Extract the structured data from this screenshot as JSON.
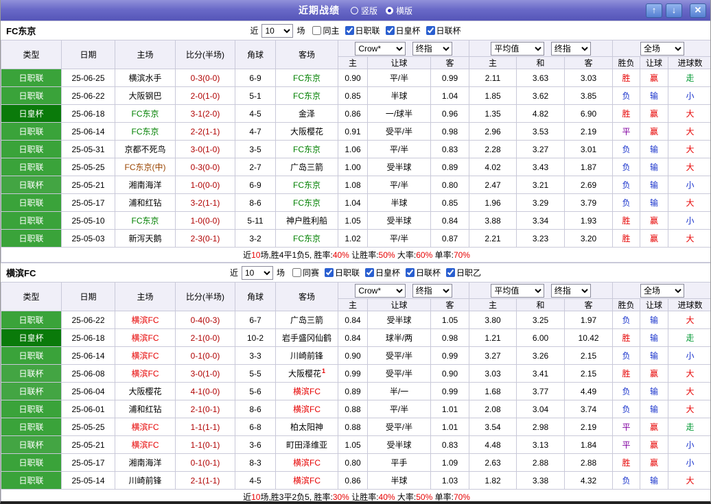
{
  "titlebar": {
    "title": "近期战绩",
    "radios": [
      {
        "label": "竖版",
        "selected": false
      },
      {
        "label": "横版",
        "selected": true
      }
    ],
    "buttons": {
      "up": "↑",
      "down": "↓",
      "close": "✕"
    }
  },
  "controls": {
    "odds_company": "Crow*",
    "odds_stage": "终指",
    "avg": "平均值",
    "avg_stage": "终指",
    "scope": "全场"
  },
  "columns": {
    "type": "类型",
    "date": "日期",
    "home": "主场",
    "score": "比分(半场)",
    "corners": "角球",
    "away": "客场",
    "odds_home": "主",
    "odds_handicap": "让球",
    "odds_away": "客",
    "avg_home": "主",
    "avg_draw": "和",
    "avg_away": "客",
    "result_wdl": "胜负",
    "result_handicap": "让球",
    "result_goals": "进球数"
  },
  "colors": {
    "accent": "#6565c8",
    "score": "#b00000",
    "type": {
      "日职联": "#3aa33a",
      "日皇杯": "#0a7a0a",
      "日联杯": "#43a543",
      "日职乙": "#3aa33a"
    },
    "team": {
      "green": "#008000",
      "red": "#e60000",
      "maroon": "#994400",
      "default": "#000000"
    },
    "result": {
      "胜": "#e60000",
      "赢": "#e60000",
      "大": "#e60000",
      "负": "#1933cc",
      "输": "#1933cc",
      "小": "#1933cc",
      "平": "#8000a0",
      "走": "#009933"
    }
  },
  "sections": [
    {
      "team": "FC东京",
      "filter": {
        "near": "近",
        "count": "10",
        "games": "场",
        "checkboxes": [
          {
            "label": "同主",
            "checked": false
          },
          {
            "label": "日职联",
            "checked": true
          },
          {
            "label": "日皇杯",
            "checked": true
          },
          {
            "label": "日联杯",
            "checked": true
          }
        ]
      },
      "rows": [
        {
          "type": "日职联",
          "date": "25-06-25",
          "home": {
            "name": "横滨水手"
          },
          "score": "0-3(0-0)",
          "corners": "6-9",
          "away": {
            "name": "FC东京",
            "color": "green"
          },
          "odds": [
            "0.90",
            "平/半",
            "0.99"
          ],
          "avg": [
            "2.11",
            "3.63",
            "3.03"
          ],
          "results": [
            "胜",
            "赢",
            "走"
          ]
        },
        {
          "type": "日职联",
          "date": "25-06-22",
          "home": {
            "name": "大阪钢巴"
          },
          "score": "2-0(1-0)",
          "corners": "5-1",
          "away": {
            "name": "FC东京",
            "color": "green"
          },
          "odds": [
            "0.85",
            "半球",
            "1.04"
          ],
          "avg": [
            "1.85",
            "3.62",
            "3.85"
          ],
          "results": [
            "负",
            "输",
            "小"
          ]
        },
        {
          "type": "日皇杯",
          "date": "25-06-18",
          "home": {
            "name": "FC东京",
            "color": "green"
          },
          "score": "3-1(2-0)",
          "corners": "4-5",
          "away": {
            "name": "金泽"
          },
          "odds": [
            "0.86",
            "一/球半",
            "0.96"
          ],
          "avg": [
            "1.35",
            "4.82",
            "6.90"
          ],
          "results": [
            "胜",
            "赢",
            "大"
          ]
        },
        {
          "type": "日职联",
          "date": "25-06-14",
          "home": {
            "name": "FC东京",
            "color": "green"
          },
          "score": "2-2(1-1)",
          "corners": "4-7",
          "away": {
            "name": "大阪樱花"
          },
          "odds": [
            "0.91",
            "受平/半",
            "0.98"
          ],
          "avg": [
            "2.96",
            "3.53",
            "2.19"
          ],
          "results": [
            "平",
            "赢",
            "大"
          ]
        },
        {
          "type": "日职联",
          "date": "25-05-31",
          "home": {
            "name": "京都不死鸟"
          },
          "score": "3-0(1-0)",
          "corners": "3-5",
          "away": {
            "name": "FC东京",
            "color": "green"
          },
          "odds": [
            "1.06",
            "平/半",
            "0.83"
          ],
          "avg": [
            "2.28",
            "3.27",
            "3.01"
          ],
          "results": [
            "负",
            "输",
            "大"
          ]
        },
        {
          "type": "日职联",
          "date": "25-05-25",
          "home": {
            "name": "FC东京(中)",
            "color": "maroon"
          },
          "score": "0-3(0-0)",
          "corners": "2-7",
          "away": {
            "name": "广岛三箭"
          },
          "odds": [
            "1.00",
            "受半球",
            "0.89"
          ],
          "avg": [
            "4.02",
            "3.43",
            "1.87"
          ],
          "results": [
            "负",
            "输",
            "大"
          ]
        },
        {
          "type": "日联杯",
          "date": "25-05-21",
          "home": {
            "name": "湘南海洋"
          },
          "score": "1-0(0-0)",
          "corners": "6-9",
          "away": {
            "name": "FC东京",
            "color": "green"
          },
          "odds": [
            "1.08",
            "平/半",
            "0.80"
          ],
          "avg": [
            "2.47",
            "3.21",
            "2.69"
          ],
          "results": [
            "负",
            "输",
            "小"
          ]
        },
        {
          "type": "日职联",
          "date": "25-05-17",
          "home": {
            "name": "浦和红钻"
          },
          "score": "3-2(1-1)",
          "corners": "8-6",
          "away": {
            "name": "FC东京",
            "color": "green"
          },
          "odds": [
            "1.04",
            "半球",
            "0.85"
          ],
          "avg": [
            "1.96",
            "3.29",
            "3.79"
          ],
          "results": [
            "负",
            "输",
            "大"
          ]
        },
        {
          "type": "日职联",
          "date": "25-05-10",
          "home": {
            "name": "FC东京",
            "color": "green"
          },
          "score": "1-0(0-0)",
          "corners": "5-11",
          "away": {
            "name": "神户胜利船"
          },
          "odds": [
            "1.05",
            "受半球",
            "0.84"
          ],
          "avg": [
            "3.88",
            "3.34",
            "1.93"
          ],
          "results": [
            "胜",
            "赢",
            "小"
          ]
        },
        {
          "type": "日职联",
          "date": "25-05-03",
          "home": {
            "name": "新泻天鹅"
          },
          "score": "2-3(0-1)",
          "corners": "3-2",
          "away": {
            "name": "FC东京",
            "color": "green"
          },
          "odds": [
            "1.02",
            "平/半",
            "0.87"
          ],
          "avg": [
            "2.21",
            "3.23",
            "3.20"
          ],
          "results": [
            "胜",
            "赢",
            "大"
          ]
        }
      ],
      "footer": [
        {
          "t": "近"
        },
        {
          "t": "10",
          "red": true
        },
        {
          "t": "场,胜4平1负5, 胜率:"
        },
        {
          "t": "40%",
          "red": true
        },
        {
          "t": " 让胜率:"
        },
        {
          "t": "50%",
          "red": true
        },
        {
          "t": " 大率:"
        },
        {
          "t": "60%",
          "red": true
        },
        {
          "t": " 单率:"
        },
        {
          "t": "70%",
          "red": true
        }
      ]
    },
    {
      "team": "横滨FC",
      "filter": {
        "near": "近",
        "count": "10",
        "games": "场",
        "checkboxes": [
          {
            "label": "同赛",
            "checked": false
          },
          {
            "label": "日职联",
            "checked": true
          },
          {
            "label": "日皇杯",
            "checked": true
          },
          {
            "label": "日联杯",
            "checked": true
          },
          {
            "label": "日职乙",
            "checked": true
          }
        ]
      },
      "rows": [
        {
          "type": "日职联",
          "date": "25-06-22",
          "home": {
            "name": "横滨FC",
            "color": "red"
          },
          "score": "0-4(0-3)",
          "corners": "6-7",
          "away": {
            "name": "广岛三箭"
          },
          "odds": [
            "0.84",
            "受半球",
            "1.05"
          ],
          "avg": [
            "3.80",
            "3.25",
            "1.97"
          ],
          "results": [
            "负",
            "输",
            "大"
          ]
        },
        {
          "type": "日皇杯",
          "date": "25-06-18",
          "home": {
            "name": "横滨FC",
            "color": "red"
          },
          "score": "2-1(0-0)",
          "corners": "10-2",
          "away": {
            "name": "岩手盛冈仙鹤"
          },
          "odds": [
            "0.84",
            "球半/两",
            "0.98"
          ],
          "avg": [
            "1.21",
            "6.00",
            "10.42"
          ],
          "results": [
            "胜",
            "输",
            "走"
          ]
        },
        {
          "type": "日职联",
          "date": "25-06-14",
          "home": {
            "name": "横滨FC",
            "color": "red"
          },
          "score": "0-1(0-0)",
          "corners": "3-3",
          "away": {
            "name": "川崎前锋"
          },
          "odds": [
            "0.90",
            "受平/半",
            "0.99"
          ],
          "avg": [
            "3.27",
            "3.26",
            "2.15"
          ],
          "results": [
            "负",
            "输",
            "小"
          ]
        },
        {
          "type": "日联杯",
          "date": "25-06-08",
          "home": {
            "name": "横滨FC",
            "color": "red"
          },
          "score": "3-0(1-0)",
          "corners": "5-5",
          "away": {
            "name": "大阪樱花",
            "sup": "1"
          },
          "odds": [
            "0.99",
            "受平/半",
            "0.90"
          ],
          "avg": [
            "3.03",
            "3.41",
            "2.15"
          ],
          "results": [
            "胜",
            "赢",
            "大"
          ]
        },
        {
          "type": "日联杯",
          "date": "25-06-04",
          "home": {
            "name": "大阪樱花"
          },
          "score": "4-1(0-0)",
          "corners": "5-6",
          "away": {
            "name": "横滨FC",
            "color": "red"
          },
          "odds": [
            "0.89",
            "半/一",
            "0.99"
          ],
          "avg": [
            "1.68",
            "3.77",
            "4.49"
          ],
          "results": [
            "负",
            "输",
            "大"
          ]
        },
        {
          "type": "日职联",
          "date": "25-06-01",
          "home": {
            "name": "浦和红钻"
          },
          "score": "2-1(0-1)",
          "corners": "8-6",
          "away": {
            "name": "横滨FC",
            "color": "red"
          },
          "odds": [
            "0.88",
            "平/半",
            "1.01"
          ],
          "avg": [
            "2.08",
            "3.04",
            "3.74"
          ],
          "results": [
            "负",
            "输",
            "大"
          ]
        },
        {
          "type": "日职联",
          "date": "25-05-25",
          "home": {
            "name": "横滨FC",
            "color": "red"
          },
          "score": "1-1(1-1)",
          "corners": "6-8",
          "away": {
            "name": "柏太阳神"
          },
          "odds": [
            "0.88",
            "受平/半",
            "1.01"
          ],
          "avg": [
            "3.54",
            "2.98",
            "2.19"
          ],
          "results": [
            "平",
            "赢",
            "走"
          ]
        },
        {
          "type": "日联杯",
          "date": "25-05-21",
          "home": {
            "name": "横滨FC",
            "color": "red"
          },
          "score": "1-1(0-1)",
          "corners": "3-6",
          "away": {
            "name": "町田泽维亚"
          },
          "odds": [
            "1.05",
            "受半球",
            "0.83"
          ],
          "avg": [
            "4.48",
            "3.13",
            "1.84"
          ],
          "results": [
            "平",
            "赢",
            "小"
          ]
        },
        {
          "type": "日职联",
          "date": "25-05-17",
          "home": {
            "name": "湘南海洋"
          },
          "score": "0-1(0-1)",
          "corners": "8-3",
          "away": {
            "name": "横滨FC",
            "color": "red"
          },
          "odds": [
            "0.80",
            "平手",
            "1.09"
          ],
          "avg": [
            "2.63",
            "2.88",
            "2.88"
          ],
          "results": [
            "胜",
            "赢",
            "小"
          ]
        },
        {
          "type": "日职联",
          "date": "25-05-14",
          "home": {
            "name": "川崎前锋"
          },
          "score": "2-1(1-1)",
          "corners": "4-5",
          "away": {
            "name": "横滨FC",
            "color": "red"
          },
          "odds": [
            "0.86",
            "半球",
            "1.03"
          ],
          "avg": [
            "1.82",
            "3.38",
            "4.32"
          ],
          "results": [
            "负",
            "输",
            "大"
          ]
        }
      ],
      "footer": [
        {
          "t": "近"
        },
        {
          "t": "10",
          "red": true
        },
        {
          "t": "场,胜3平2负5, 胜率:"
        },
        {
          "t": "30%",
          "red": true
        },
        {
          "t": " 让胜率:"
        },
        {
          "t": "40%",
          "red": true
        },
        {
          "t": " 大率:"
        },
        {
          "t": "50%",
          "red": true
        },
        {
          "t": " 单率:"
        },
        {
          "t": "70%",
          "red": true
        }
      ]
    }
  ]
}
